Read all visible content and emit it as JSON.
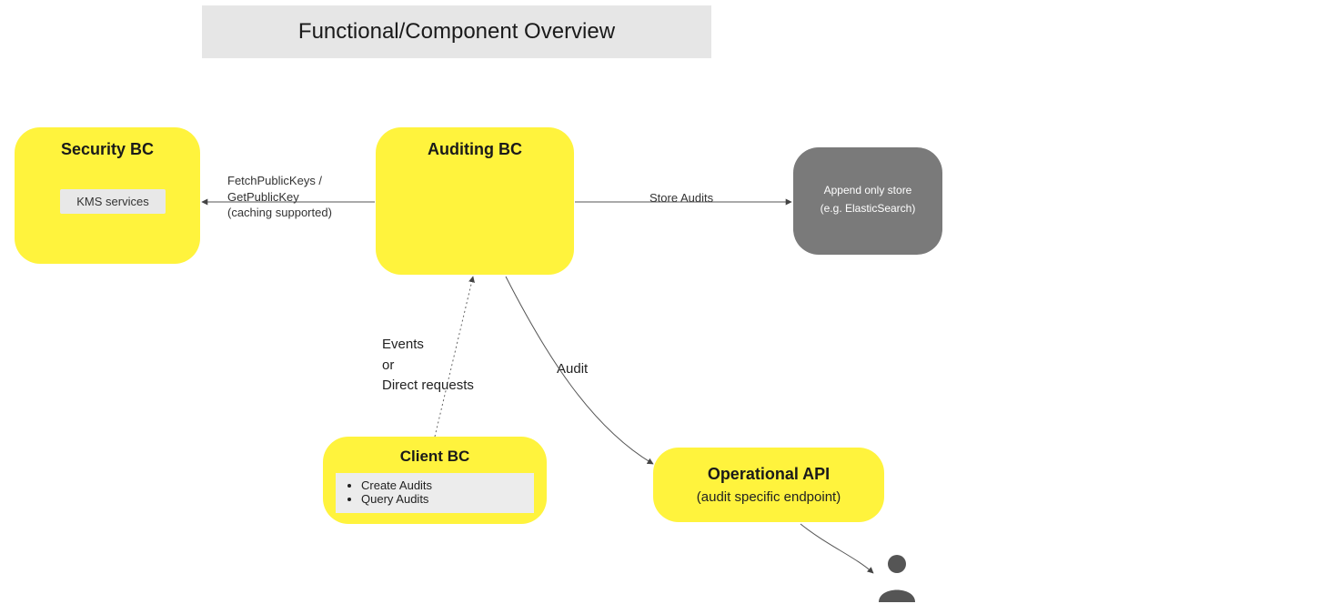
{
  "title": "Functional/Component Overview",
  "nodes": {
    "security": {
      "title": "Security BC",
      "service": "KMS services"
    },
    "auditing": {
      "title": "Auditing BC"
    },
    "store": {
      "line1": "Append only store",
      "line2": "(e.g. ElasticSearch)"
    },
    "client": {
      "title": "Client BC",
      "items": [
        "Create Audits",
        "Query Audits"
      ]
    },
    "opapi": {
      "title": "Operational API",
      "subtitle": "(audit specific endpoint)"
    }
  },
  "edges": {
    "fetch": {
      "line1": "FetchPublicKeys /",
      "line2": "GetPublicKey",
      "line3": "(caching supported)"
    },
    "store_audits": "Store Audits",
    "events": {
      "line1": "Events",
      "line2": "or",
      "line3": "Direct requests"
    },
    "audit": "Audit"
  }
}
